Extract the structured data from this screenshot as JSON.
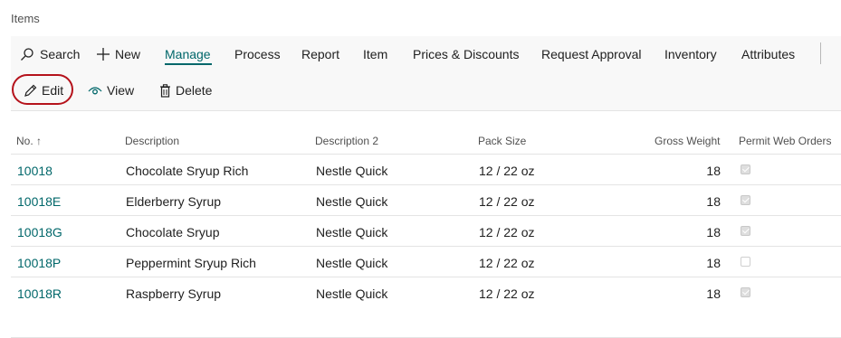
{
  "page": {
    "title": "Items"
  },
  "actionbar": {
    "search": "Search",
    "new": "New",
    "manage": "Manage",
    "process": "Process",
    "report": "Report",
    "item": "Item",
    "prices": "Prices & Discounts",
    "request": "Request Approval",
    "inventory": "Inventory",
    "attributes": "Attributes"
  },
  "subactions": {
    "edit": "Edit",
    "view": "View",
    "delete": "Delete"
  },
  "table": {
    "columns": {
      "no": "No. ↑",
      "description": "Description",
      "description2": "Description 2",
      "pack_size": "Pack Size",
      "gross_weight": "Gross Weight",
      "permit": "Permit Web Orders"
    },
    "rows": [
      {
        "no": "10018",
        "description": "Chocolate Sryup Rich",
        "description2": "Nestle Quick",
        "pack_size": "12 / 22 oz",
        "gross_weight": "18",
        "permit": true
      },
      {
        "no": "10018E",
        "description": "Elderberry Syrup",
        "description2": "Nestle Quick",
        "pack_size": "12 / 22 oz",
        "gross_weight": "18",
        "permit": true
      },
      {
        "no": "10018G",
        "description": "Chocolate Sryup",
        "description2": "Nestle Quick",
        "pack_size": "12 / 22 oz",
        "gross_weight": "18",
        "permit": true
      },
      {
        "no": "10018P",
        "description": "Peppermint Sryup Rich",
        "description2": "Nestle Quick",
        "pack_size": "12 / 22 oz",
        "gross_weight": "18",
        "permit": false
      },
      {
        "no": "10018R",
        "description": "Raspberry Syrup",
        "description2": "Nestle Quick",
        "pack_size": "12 / 22 oz",
        "gross_weight": "18",
        "permit": true
      }
    ]
  },
  "colors": {
    "accent": "#00676a",
    "highlight_ring": "#b5121b"
  }
}
